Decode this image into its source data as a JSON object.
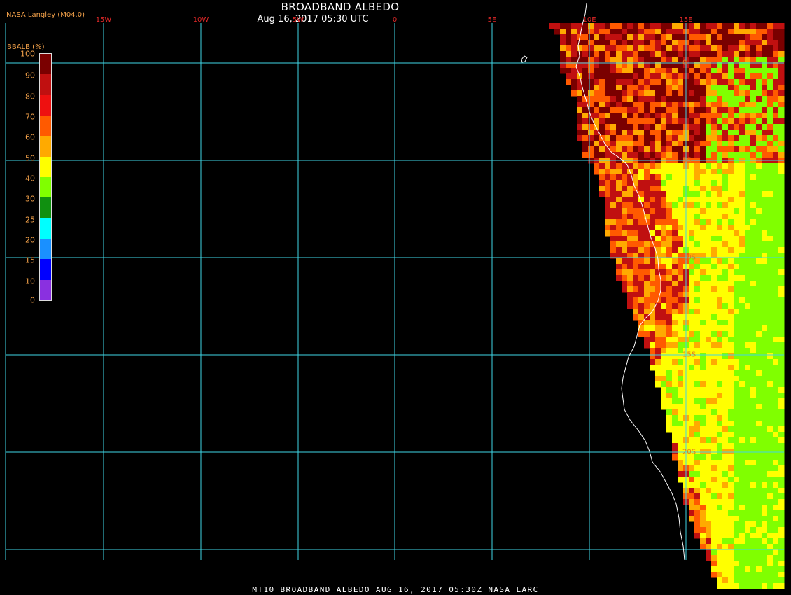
{
  "header": {
    "title": "BROADBAND ALBEDO",
    "subtitle": "Aug 16, 2017 05:30 UTC",
    "producer": "NASA Langley (M04.0)"
  },
  "footer": {
    "text": "MT10  BROADBAND ALBEDO   AUG 16, 2017 05:30Z   NASA LARC"
  },
  "legend": {
    "title": "BBALB (%)",
    "ticks": [
      "100",
      "90",
      "80",
      "70",
      "60",
      "50",
      "40",
      "30",
      "25",
      "20",
      "15",
      "10",
      "0"
    ],
    "colors": [
      "#7a0000",
      "#c01010",
      "#ee1010",
      "#ff5a00",
      "#ffaa00",
      "#ffff00",
      "#80ff00",
      "#109010",
      "#00ffff",
      "#1a90ff",
      "#0000ff",
      "#8a30e0"
    ]
  },
  "map": {
    "lon_labels": [
      "15W",
      "10W",
      "5W",
      "0",
      "5E",
      "10E",
      "15E"
    ],
    "lat_labels": [
      "0",
      "5S",
      "10S",
      "15S",
      "20S"
    ],
    "grid_color": "#3fd6e6",
    "coast_color": "#ffffff",
    "albedo_palette": [
      "#7a0000",
      "#c01010",
      "#ff5a00",
      "#ffaa00",
      "#ffff00",
      "#80ff00"
    ]
  }
}
